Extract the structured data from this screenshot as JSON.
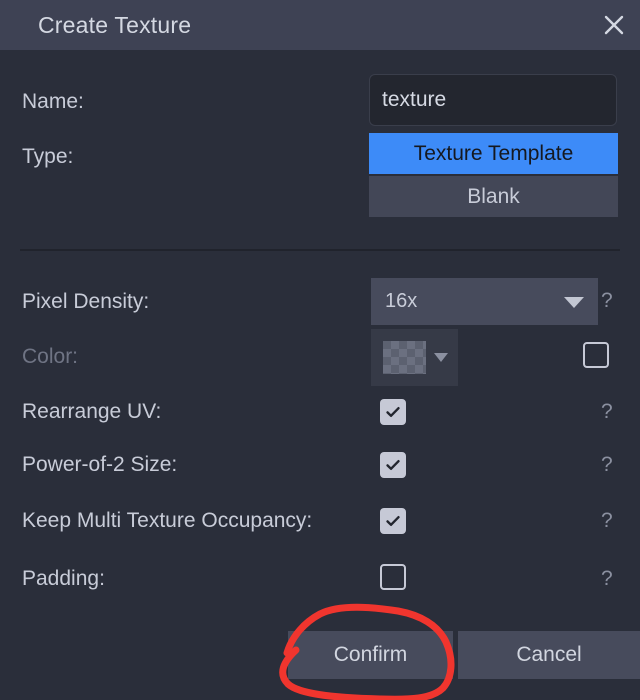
{
  "window": {
    "title": "Create Texture",
    "close_icon": "close-icon"
  },
  "form": {
    "name": {
      "label": "Name:",
      "value": "texture",
      "placeholder": ""
    },
    "type": {
      "label": "Type:",
      "options": [
        "Texture Template",
        "Blank"
      ],
      "selected": "Texture Template"
    },
    "pixel_density": {
      "label": "Pixel Density:",
      "value": "16x",
      "help": "?",
      "dropdown_icon": "chevron-down-icon"
    },
    "color": {
      "label": "Color:",
      "disabled": true,
      "swatch": "checkerboard-transparent",
      "dropdown_icon": "chevron-down-icon",
      "checkbox_checked": false
    },
    "rearrange_uv": {
      "label": "Rearrange UV:",
      "checked": true,
      "help": "?"
    },
    "power_of_2_size": {
      "label": "Power-of-2 Size:",
      "checked": true,
      "help": "?"
    },
    "keep_multi_texture_occupancy": {
      "label": "Keep Multi Texture Occupancy:",
      "checked": true,
      "help": "?"
    },
    "padding": {
      "label": "Padding:",
      "checked": false,
      "help": "?"
    }
  },
  "footer": {
    "confirm_label": "Confirm",
    "cancel_label": "Cancel"
  },
  "annotation": {
    "shape": "hand-drawn-circle",
    "target": "Confirm",
    "color": "#f0352e"
  },
  "colors": {
    "titlebar": "#3e4254",
    "body": "#2a2e3a",
    "accent": "#3d8bf8",
    "button": "#474b5c",
    "input": "#23262f",
    "text": "#c8ccd8",
    "text_disabled": "#6f7484",
    "annotation_red": "#f0352e"
  }
}
